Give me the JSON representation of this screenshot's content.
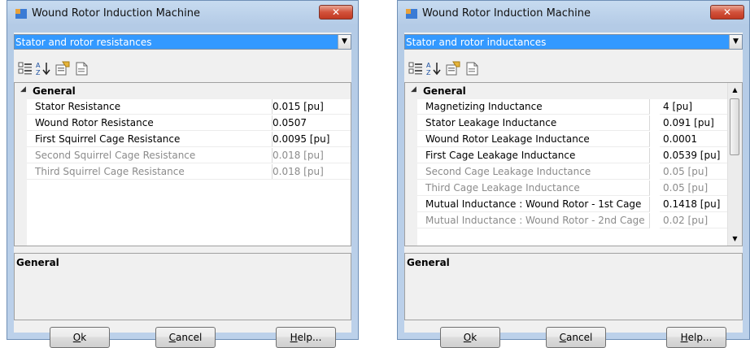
{
  "left_window": {
    "title": "Wound Rotor Induction Machine",
    "close_label": "✕",
    "category_selector": "Stator and rotor resistances",
    "grid": {
      "category": "General",
      "properties": [
        {
          "name": "Stator Resistance",
          "value": "0.015 [pu]",
          "enabled": true
        },
        {
          "name": "Wound Rotor Resistance",
          "value": "0.0507",
          "enabled": true
        },
        {
          "name": "First Squirrel Cage Resistance",
          "value": "0.0095 [pu]",
          "enabled": true
        },
        {
          "name": "Second Squirrel Cage Resistance",
          "value": "0.018 [pu]",
          "enabled": false
        },
        {
          "name": "Third Squirrel Cage Resistance",
          "value": "0.018 [pu]",
          "enabled": false
        }
      ]
    },
    "description_title": "General",
    "buttons": {
      "ok_key": "O",
      "ok_rest": "k",
      "cancel_key": "C",
      "cancel_rest": "ancel",
      "help_key": "H",
      "help_rest": "elp..."
    }
  },
  "right_window": {
    "title": "Wound Rotor Induction Machine",
    "close_label": "✕",
    "category_selector": "Stator and rotor inductances",
    "grid": {
      "category": "General",
      "properties": [
        {
          "name": "Magnetizing Inductance",
          "value": "4 [pu]",
          "enabled": true
        },
        {
          "name": "Stator Leakage Inductance",
          "value": "0.091 [pu]",
          "enabled": true
        },
        {
          "name": "Wound Rotor Leakage Inductance",
          "value": "0.0001",
          "enabled": true
        },
        {
          "name": "First Cage Leakage Inductance",
          "value": "0.0539 [pu]",
          "enabled": true
        },
        {
          "name": "Second Cage Leakage Inductance",
          "value": "0.05 [pu]",
          "enabled": false
        },
        {
          "name": "Third Cage Leakage Inductance",
          "value": "0.05 [pu]",
          "enabled": false
        },
        {
          "name": "Mutual Inductance : Wound Rotor - 1st Cage",
          "value": "0.1418 [pu]",
          "enabled": true
        },
        {
          "name": "Mutual Inductance : Wound Rotor - 2nd Cage",
          "value": "0.02 [pu]",
          "enabled": false
        }
      ]
    },
    "description_title": "General",
    "buttons": {
      "ok_key": "O",
      "ok_rest": "k",
      "cancel_key": "C",
      "cancel_rest": "ancel",
      "help_key": "H",
      "help_rest": "elp..."
    }
  },
  "icons": {
    "app": "app-window-icon",
    "close": "close-icon",
    "dropdown": "chevron-down-icon",
    "categorized": "categorized-view-icon",
    "alphabetical": "sort-alphabetical-icon",
    "property_pages": "property-pages-icon",
    "new_page": "new-page-icon",
    "collapse": "collapse-triangle-icon",
    "scroll_up": "scroll-up-icon",
    "scroll_down": "scroll-down-icon"
  },
  "colors": {
    "selection": "#3399ff",
    "close_button": "#c13a23",
    "disabled_text": "#8b8b8b",
    "frame": "#bcd1ea"
  }
}
